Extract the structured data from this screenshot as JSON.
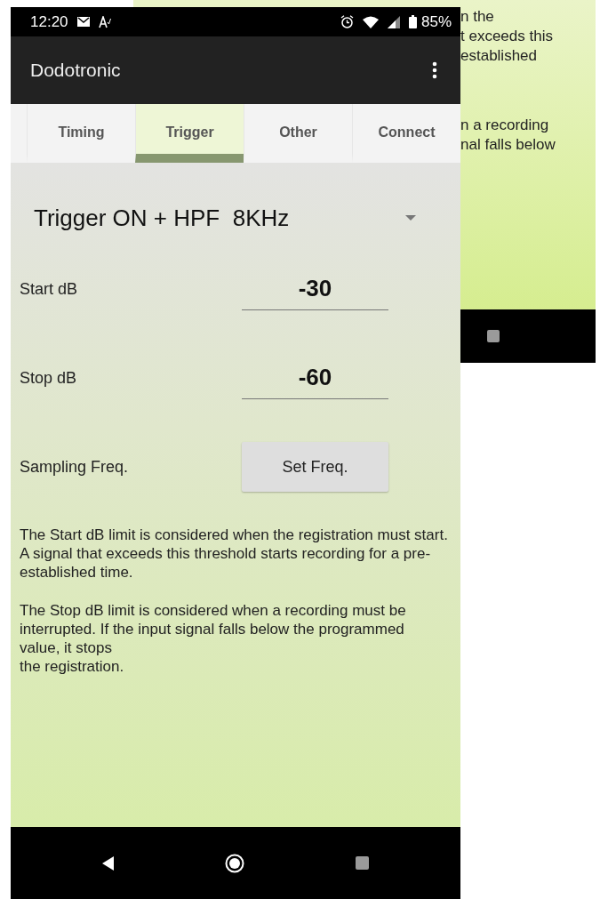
{
  "back_screen": {
    "paragraphs": [
      [
        "n the",
        "t exceeds this",
        "established"
      ],
      [
        "n a recording",
        "nal falls below"
      ]
    ]
  },
  "status_bar": {
    "time": "12:20",
    "battery": "85%"
  },
  "app_bar": {
    "title": "Dodotronic"
  },
  "tabs": [
    {
      "label": "Timing",
      "selected": false
    },
    {
      "label": "Trigger",
      "selected": true
    },
    {
      "label": "Other",
      "selected": false
    },
    {
      "label": "Connect",
      "selected": false
    }
  ],
  "trigger_mode": {
    "value": "Trigger ON + HPF  8KHz"
  },
  "fields": [
    {
      "label": "Start dB",
      "value": "-30"
    },
    {
      "label": "Stop dB",
      "value": "-60"
    }
  ],
  "sampling": {
    "label": "Sampling Freq.",
    "button": "Set Freq."
  },
  "help": [
    "The Start dB limit is considered when the registration must start. A signal that exceeds this threshold starts recording for a pre-established time.",
    "The Stop dB limit is considered when a recording must be interrupted. If the input signal falls below the programmed value, it stops\nthe registration."
  ]
}
